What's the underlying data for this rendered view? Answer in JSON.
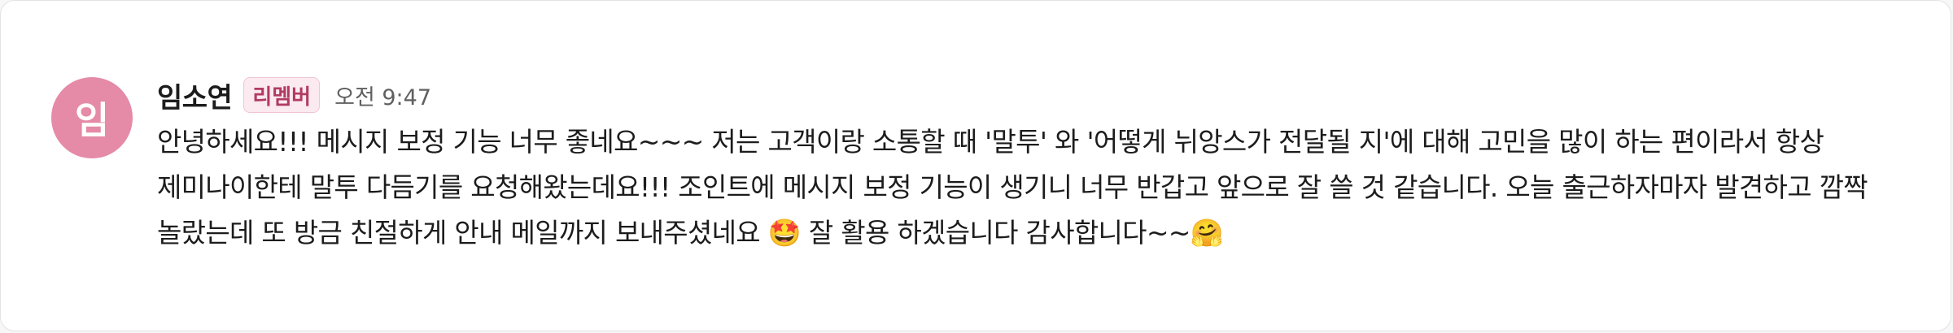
{
  "message": {
    "avatar_initial": "임",
    "sender_name": "임소연",
    "badge_label": "리멤버",
    "timestamp": "오전 9:47",
    "text": "안녕하세요!!! 메시지 보정 기능 너무 좋네요~~~ 저는 고객이랑 소통할 때 '말투' 와 '어떻게 뉘앙스가 전달될 지'에 대해 고민을 많이 하는 편이라서 항상 제미나이한테 말투 다듬기를 요청해왔는데요!!! 조인트에 메시지 보정 기능이 생기니 너무 반갑고 앞으로 잘 쓸 것 같습니다. 오늘 출근하자마자 발견하고 깜짝 놀랐는데 또 방금 친절하게 안내 메일까지 보내주셨네요 🤩 잘 활용 하겠습니다 감사합니다~~🤗"
  },
  "colors": {
    "avatar_bg": "#e58aa7",
    "badge_bg": "#fbeaf0",
    "badge_text": "#b23a62"
  }
}
